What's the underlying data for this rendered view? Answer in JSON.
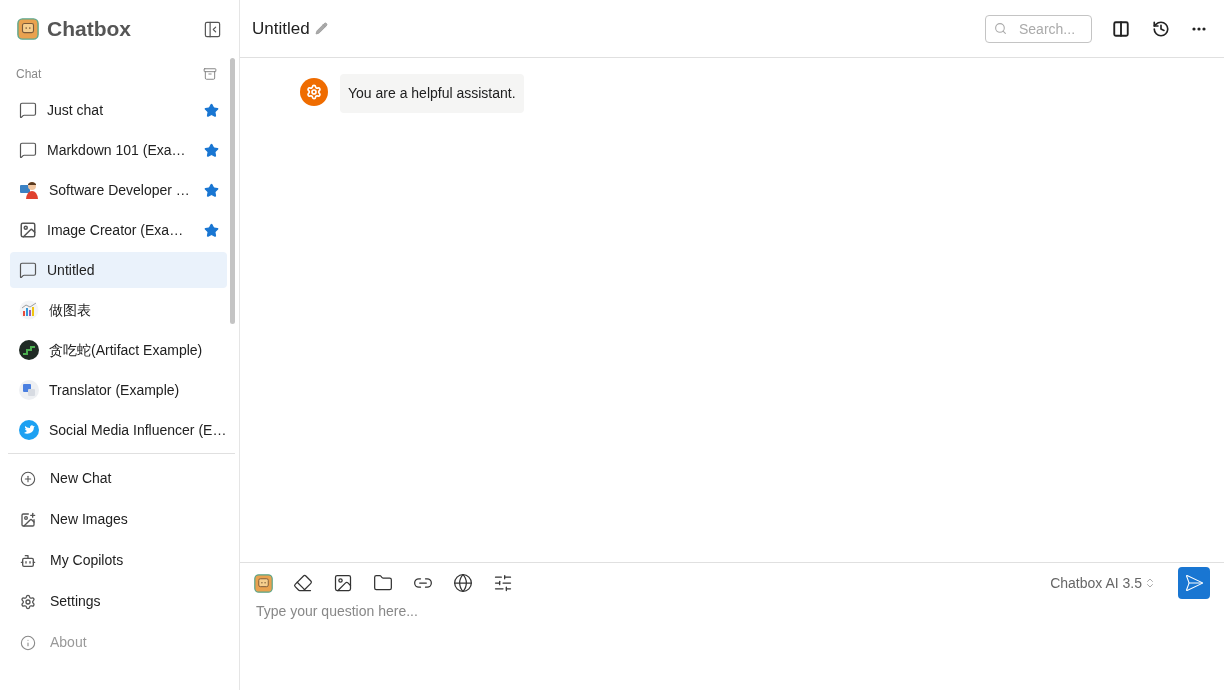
{
  "app": {
    "name": "Chatbox"
  },
  "sidebar": {
    "section_label": "Chat",
    "sessions": [
      {
        "title": "Just chat",
        "kind": "chat",
        "starred": true,
        "selected": false
      },
      {
        "title": "Markdown 101 (Exa…",
        "kind": "chat",
        "starred": true,
        "selected": false
      },
      {
        "title": "Software Developer …",
        "kind": "developer",
        "starred": true,
        "selected": false
      },
      {
        "title": "Image Creator (Exa…",
        "kind": "image",
        "starred": true,
        "selected": false
      },
      {
        "title": "Untitled",
        "kind": "chat",
        "starred": false,
        "selected": true
      },
      {
        "title": "做图表",
        "kind": "chart",
        "starred": false,
        "selected": false
      },
      {
        "title": "贪吃蛇(Artifact Example)",
        "kind": "snake",
        "starred": false,
        "selected": false
      },
      {
        "title": "Translator (Example)",
        "kind": "translator",
        "starred": false,
        "selected": false
      },
      {
        "title": "Social Media Influencer (E…",
        "kind": "bird",
        "starred": false,
        "selected": false
      }
    ],
    "menu": [
      {
        "label": "New Chat",
        "kind": "new-chat",
        "disabled": false
      },
      {
        "label": "New Images",
        "kind": "new-images",
        "disabled": false
      },
      {
        "label": "My Copilots",
        "kind": "copilots",
        "disabled": false
      },
      {
        "label": "Settings",
        "kind": "settings",
        "disabled": false
      },
      {
        "label": "About",
        "kind": "about",
        "disabled": true
      }
    ]
  },
  "header": {
    "title": "Untitled",
    "search": {
      "placeholder": "Search..."
    }
  },
  "messages": [
    {
      "kind": "system",
      "text": "You are a helpful assistant."
    }
  ],
  "composer": {
    "model": "Chatbox AI 3.5",
    "placeholder": "Type your question here..."
  }
}
